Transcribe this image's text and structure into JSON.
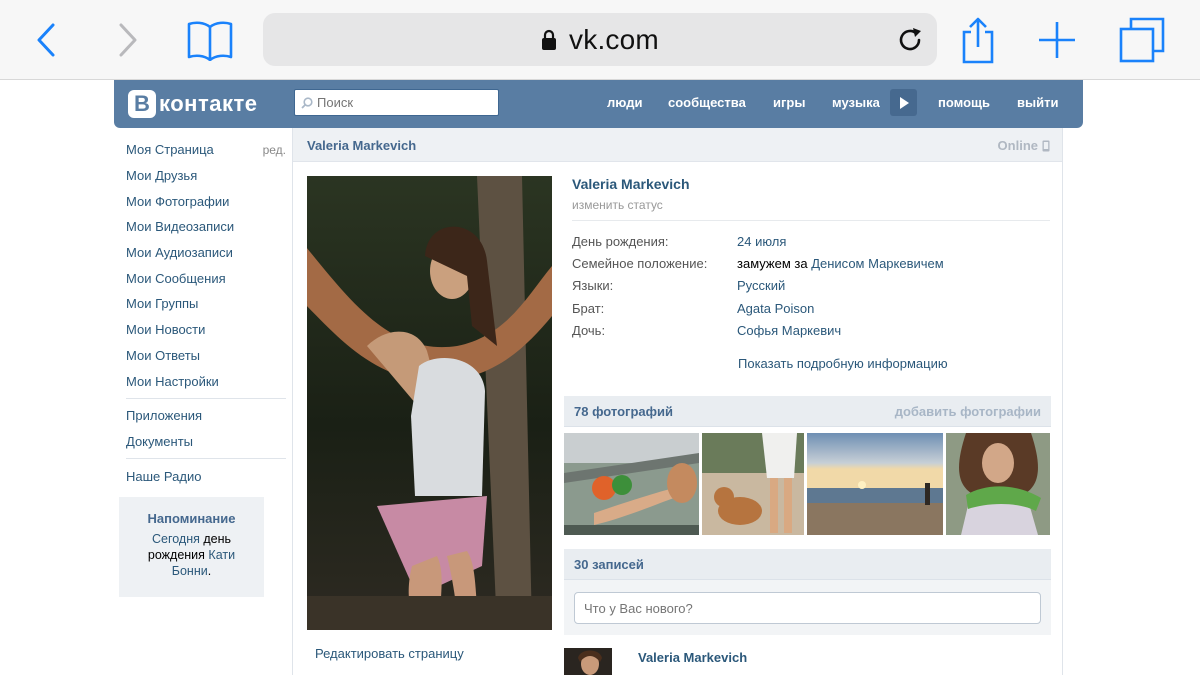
{
  "browser": {
    "url": "vk.com"
  },
  "header": {
    "logo_badge": "В",
    "logo_word": "контакте",
    "search_placeholder": "Поиск",
    "nav": [
      {
        "label": "люди"
      },
      {
        "label": "сообщества"
      },
      {
        "label": "игры"
      },
      {
        "label": "музыка"
      },
      {
        "label": "помощь"
      },
      {
        "label": "выйти"
      }
    ],
    "colors": {
      "brand": "#597da3",
      "link": "#2b587a"
    }
  },
  "left_menu": {
    "items": [
      {
        "label": "Моя Страница",
        "extra": "ред."
      },
      {
        "label": "Мои Друзья"
      },
      {
        "label": "Мои Фотографии"
      },
      {
        "label": "Мои Видеозаписи"
      },
      {
        "label": "Мои Аудиозаписи"
      },
      {
        "label": "Мои Сообщения"
      },
      {
        "label": "Мои Группы"
      },
      {
        "label": "Мои Новости"
      },
      {
        "label": "Мои Ответы"
      },
      {
        "label": "Мои Настройки"
      }
    ],
    "secondary": [
      {
        "label": "Приложения"
      },
      {
        "label": "Документы"
      }
    ],
    "tertiary": [
      {
        "label": "Наше Радио"
      }
    ]
  },
  "reminder": {
    "title": "Напоминание",
    "line1_link": "Сегодня",
    "line1_text": " день",
    "line2_text": "рождения ",
    "line2_link": "Кати",
    "line3_link": "Бонни",
    "line3_tail": "."
  },
  "profile": {
    "header_name": "Valeria Markevich",
    "online": "Online",
    "name": "Valeria Markevich",
    "status": "изменить статус",
    "rows": [
      {
        "label": "День рождения:",
        "value": "24 июля"
      },
      {
        "label": "Семейное положение:",
        "value_plain": "замужем за ",
        "value": "Денисом Маркевичем"
      },
      {
        "label": "Языки:",
        "value": "Русский"
      },
      {
        "label": "Брат:",
        "value": "Agata Poison"
      },
      {
        "label": "Дочь:",
        "value": "Софья Маркевич"
      }
    ],
    "more": "Показать подробную информацию",
    "edit_page": "Редактировать страницу"
  },
  "photos": {
    "title": "78 фотографий",
    "action": "добавить фотографии"
  },
  "wall": {
    "title": "30 записей",
    "placeholder": "Что у Вас нового?",
    "post_author": "Valeria Markevich"
  }
}
